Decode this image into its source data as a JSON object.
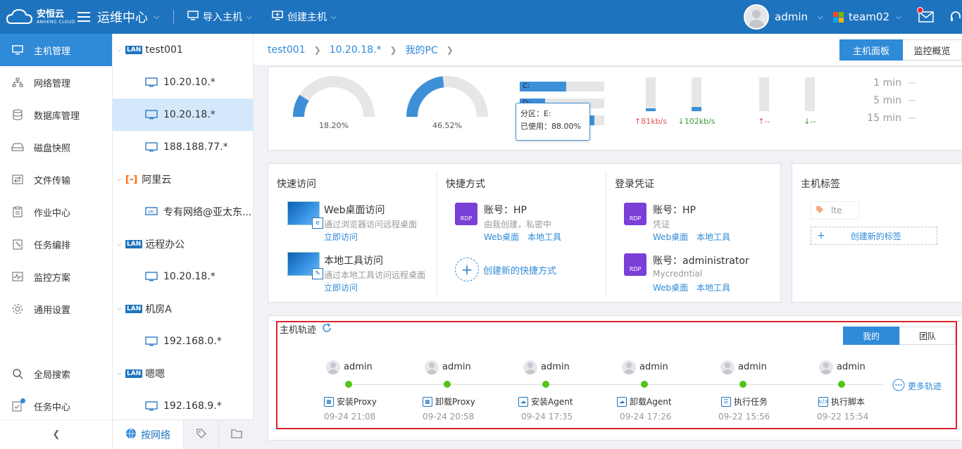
{
  "brand": {
    "cn": "安恒云",
    "en": "ANHENG CLOUD"
  },
  "header": {
    "app_title": "运维中心",
    "import_label": "导入主机",
    "create_label": "创建主机",
    "user": "admin",
    "team": "team02"
  },
  "sidebar": {
    "items": [
      {
        "label": "主机管理",
        "icon": "monitor-icon"
      },
      {
        "label": "网络管理",
        "icon": "network-icon"
      },
      {
        "label": "数据库管理",
        "icon": "database-icon"
      },
      {
        "label": "磁盘快照",
        "icon": "disk-icon"
      },
      {
        "label": "文件传输",
        "icon": "file-transfer-icon"
      },
      {
        "label": "作业中心",
        "icon": "clipboard-icon"
      },
      {
        "label": "任务编排",
        "icon": "task-flow-icon"
      },
      {
        "label": "监控方案",
        "icon": "chart-pulse-icon"
      },
      {
        "label": "通用设置",
        "icon": "gear-icon"
      },
      {
        "label": "全局搜索",
        "icon": "search-icon"
      },
      {
        "label": "任务中心",
        "icon": "task-check-icon"
      }
    ]
  },
  "tree": {
    "groups": [
      {
        "badge": "LAN",
        "name": "test001",
        "children": [
          "10.20.10.*",
          "10.20.18.*",
          "188.188.77.*"
        ]
      },
      {
        "badge": "",
        "name": "阿里云",
        "children": [
          "专有网络@亚太东..."
        ]
      },
      {
        "badge": "LAN",
        "name": "远程办公",
        "children": [
          "10.20.18.*"
        ]
      },
      {
        "badge": "LAN",
        "name": "机房A",
        "children": [
          "192.168.0.*"
        ]
      },
      {
        "badge": "LAN",
        "name": "嗯嗯",
        "children": [
          "192.168.9.*"
        ]
      }
    ],
    "bottom_tab": "按网络"
  },
  "breadcrumb": [
    "test001",
    "10.20.18.*",
    "我的PC"
  ],
  "view_tabs": [
    "主机面板",
    "监控概览"
  ],
  "metrics": {
    "cpu_percent": 18.2,
    "cpu_label": "18.20%",
    "mem_percent": 46.52,
    "mem_label": "46.52%",
    "disks": [
      {
        "name": "C:",
        "used": 0.55
      },
      {
        "name": "D:",
        "used": 0.3
      },
      {
        "name": "E:",
        "used": 0.88
      }
    ],
    "tooltip_line1": "分区：E:",
    "tooltip_line2": "已使用：88.00%",
    "net_up_label": "↑81kb/s",
    "net_down_label": "↓102kb/s",
    "net_up_level": 0.08,
    "net_down_level": 0.12,
    "io_up_label": "↑--",
    "io_down_label": "↓--",
    "loads": [
      {
        "label": "1 min",
        "value": "--"
      },
      {
        "label": "5 min",
        "value": "--"
      },
      {
        "label": "15 min",
        "value": "--"
      }
    ]
  },
  "quick_access": {
    "title": "快速访问",
    "items": [
      {
        "title": "Web桌面访问",
        "desc": "通过浏览器访问远程桌面",
        "link": "立即访问"
      },
      {
        "title": "本地工具访问",
        "desc": "通过本地工具访问远程桌面",
        "link": "立即访问"
      }
    ]
  },
  "shortcuts": {
    "title": "快捷方式",
    "account": "账号：HP",
    "desc": "由我创建，私密中",
    "link_web": "Web桌面",
    "link_local": "本地工具",
    "create_label": "创建新的快捷方式"
  },
  "credentials": {
    "title": "登录凭证",
    "items": [
      {
        "account": "账号：HP",
        "desc": "凭证",
        "link_web": "Web桌面",
        "link_local": "本地工具"
      },
      {
        "account": "账号：administrator",
        "desc": "Mycredntial",
        "link_web": "Web桌面",
        "link_local": "本地工具"
      }
    ]
  },
  "tags": {
    "title": "主机标签",
    "existing": "lte",
    "create_label": "创建新的标签"
  },
  "trail": {
    "title": "主机轨迹",
    "tabs": [
      "我的",
      "团队"
    ],
    "more_label": "更多轨迹",
    "events": [
      {
        "user": "admin",
        "action": "安装Proxy",
        "time": "09-24 21:08",
        "icon": "proxy-icon"
      },
      {
        "user": "admin",
        "action": "卸载Proxy",
        "time": "09-24 20:58",
        "icon": "proxy-icon"
      },
      {
        "user": "admin",
        "action": "安装Agent",
        "time": "09-24 17:35",
        "icon": "cloud-agent-icon"
      },
      {
        "user": "admin",
        "action": "卸载Agent",
        "time": "09-24 17:26",
        "icon": "cloud-agent-icon"
      },
      {
        "user": "admin",
        "action": "执行任务",
        "time": "09-22 15:56",
        "icon": "clipboard-task-icon"
      },
      {
        "user": "admin",
        "action": "执行脚本",
        "time": "09-22 15:54",
        "icon": "code-script-icon"
      }
    ]
  },
  "colors": {
    "primary": "#1e73be",
    "accent": "#2f8ad8",
    "success": "#52c41a",
    "highlight": "#d9232b"
  }
}
